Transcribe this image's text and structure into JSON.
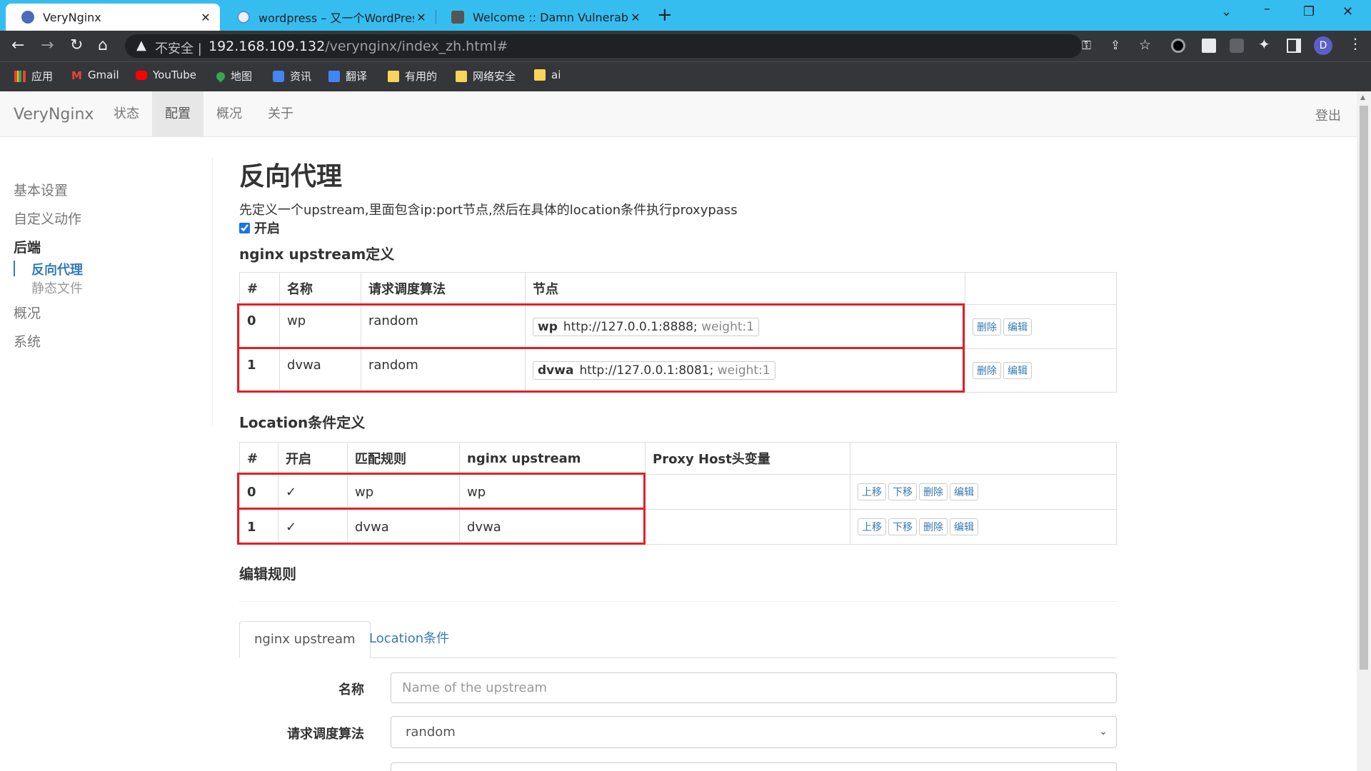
{
  "browser": {
    "tabs": [
      {
        "title": "VeryNginx",
        "active": true
      },
      {
        "title": "wordpress – 又一个WordPress站",
        "active": false
      },
      {
        "title": "Welcome :: Damn Vulnerable \\",
        "active": false
      }
    ],
    "close_glyph": "✕",
    "new_tab_glyph": "+",
    "address": {
      "warning": "▲",
      "insecure": "不安全",
      "separator": "|",
      "host": "192.168.109.132",
      "path": "/verynginx/index_zh.html#"
    },
    "bookmarks": [
      "应用",
      "Gmail",
      "YouTube",
      "地图",
      "资讯",
      "翻译",
      "有用的",
      "网络安全",
      "ai"
    ],
    "profile_initial": "D",
    "accent_color": "#36bdf0"
  },
  "topnav": {
    "brand": "VeryNginx",
    "items": [
      "状态",
      "配置",
      "概况",
      "关于"
    ],
    "active": "配置",
    "logout": "登出"
  },
  "sidebar": {
    "items": [
      "基本设置",
      "自定义动作",
      "后端",
      "概况",
      "系统"
    ],
    "active": "后端",
    "sub_items": [
      "反向代理",
      "静态文件"
    ],
    "active_sub": "反向代理"
  },
  "main": {
    "title": "反向代理",
    "description": "先定义一个upstream,里面包含ip:port节点,然后在具体的location条件执行proxypass",
    "enable_label": "开启",
    "upstream_section": {
      "title": "nginx upstream定义",
      "headers": [
        "#",
        "名称",
        "请求调度算法",
        "节点",
        ""
      ],
      "rows": [
        {
          "idx": "0",
          "name": "wp",
          "method": "random",
          "node_name": "wp",
          "node_addr": "http://127.0.0.1:8888;",
          "node_weight": "weight:1",
          "btn_delete": "删除",
          "btn_edit": "编辑"
        },
        {
          "idx": "1",
          "name": "dvwa",
          "method": "random",
          "node_name": "dvwa",
          "node_addr": "http://127.0.0.1:8081;",
          "node_weight": "weight:1",
          "btn_delete": "删除",
          "btn_edit": "编辑"
        }
      ]
    },
    "location_section": {
      "title": "Location条件定义",
      "headers": [
        "#",
        "开启",
        "匹配规则",
        "nginx upstream",
        "Proxy Host头变量",
        ""
      ],
      "rows": [
        {
          "idx": "0",
          "enabled": "✓",
          "matcher": "wp",
          "upstream": "wp",
          "proxy_host": "",
          "btn_up": "上移",
          "btn_down": "下移",
          "btn_delete": "删除",
          "btn_edit": "编辑"
        },
        {
          "idx": "1",
          "enabled": "✓",
          "matcher": "dvwa",
          "upstream": "dvwa",
          "proxy_host": "",
          "btn_up": "上移",
          "btn_down": "下移",
          "btn_delete": "删除",
          "btn_edit": "编辑"
        }
      ]
    },
    "edit_section": {
      "title": "编辑规则",
      "tabs": [
        "nginx upstream",
        "Location条件"
      ],
      "active_tab": "nginx upstream",
      "name_label": "名称",
      "name_placeholder": "Name of the upstream",
      "method_label": "请求调度算法",
      "method_value": "random"
    }
  }
}
